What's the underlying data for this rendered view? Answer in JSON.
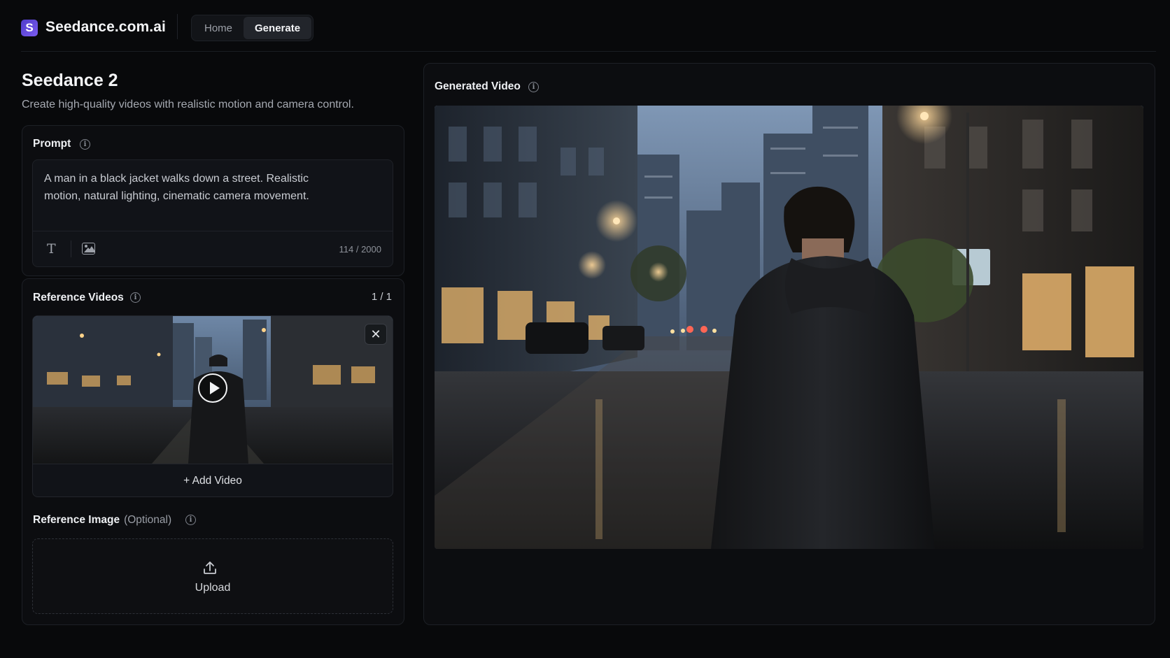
{
  "header": {
    "logo_letter": "S",
    "brand": "Seedance.com.ai",
    "nav": [
      {
        "label": "Home",
        "active": false
      },
      {
        "label": "Generate",
        "active": true
      }
    ]
  },
  "page": {
    "title": "Seedance 2",
    "subtitle": "Create high-quality videos with realistic motion and camera control."
  },
  "prompt": {
    "label": "Prompt",
    "text": "A man in a black jacket walks down a street. Realistic motion, natural lighting, cinematic camera movement.",
    "char_count": "114 / 2000",
    "tools": [
      "text-tool-icon",
      "image-tool-icon"
    ]
  },
  "reference_videos": {
    "label": "Reference Videos",
    "count": "1 / 1",
    "close_glyph": "✕",
    "add_label": "+ Add Video"
  },
  "reference_image": {
    "label": "Reference Image",
    "optional": "(Optional)",
    "upload_label": "Upload"
  },
  "generated": {
    "label": "Generated Video"
  },
  "colors": {
    "background": "#08090b",
    "panel": "#0c0d10",
    "border": "#1d2026",
    "accent": "#6a4fe6"
  }
}
